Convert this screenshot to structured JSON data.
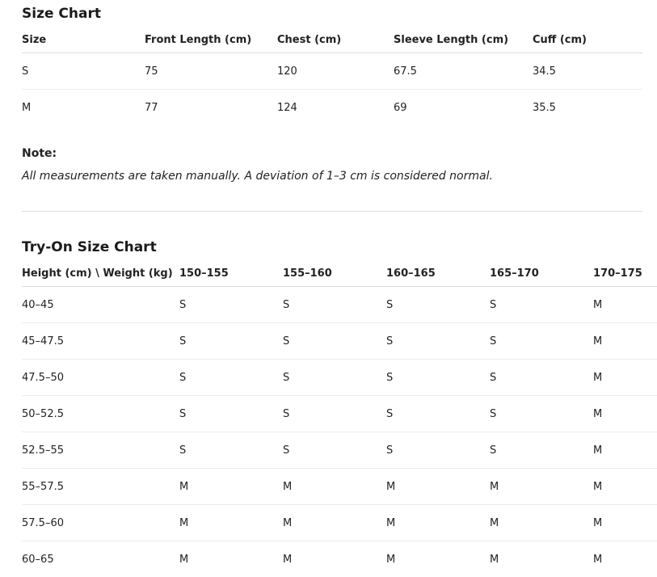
{
  "size_chart": {
    "title": "Size Chart",
    "headers": [
      "Size",
      "Front Length (cm)",
      "Chest (cm)",
      "Sleeve Length (cm)",
      "Cuff (cm)"
    ],
    "rows": [
      [
        "S",
        "75",
        "120",
        "67.5",
        "34.5"
      ],
      [
        "M",
        "77",
        "124",
        "69",
        "35.5"
      ]
    ]
  },
  "note": {
    "title": "Note:",
    "text": "All measurements are taken manually. A deviation of 1–3 cm is considered normal."
  },
  "tryon_chart": {
    "title": "Try-On Size Chart",
    "headers": [
      "Height (cm) \\ Weight (kg)",
      "150–155",
      "155–160",
      "160–165",
      "165–170",
      "170–175"
    ],
    "rows": [
      [
        "40–45",
        "S",
        "S",
        "S",
        "S",
        "M"
      ],
      [
        "45–47.5",
        "S",
        "S",
        "S",
        "S",
        "M"
      ],
      [
        "47.5–50",
        "S",
        "S",
        "S",
        "S",
        "M"
      ],
      [
        "50–52.5",
        "S",
        "S",
        "S",
        "S",
        "M"
      ],
      [
        "52.5–55",
        "S",
        "S",
        "S",
        "S",
        "M"
      ],
      [
        "55–57.5",
        "M",
        "M",
        "M",
        "M",
        "M"
      ],
      [
        "57.5–60",
        "M",
        "M",
        "M",
        "M",
        "M"
      ],
      [
        "60–65",
        "M",
        "M",
        "M",
        "M",
        "M"
      ]
    ]
  }
}
